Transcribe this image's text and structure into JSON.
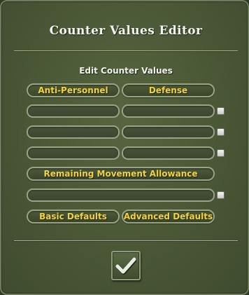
{
  "dialog": {
    "title": "Counter Values Editor",
    "subtitle": "Edit Counter Values"
  },
  "buttons": {
    "anti_personnel": "Anti-Personnel",
    "defense": "Defense",
    "remaining_movement": "Remaining Movement Allowance",
    "basic_defaults": "Basic Defaults",
    "advanced_defaults": "Advanced Defaults"
  },
  "fields": {
    "row1_left": "",
    "row1_right": "",
    "row2_left": "",
    "row2_right": "",
    "row3_left": "",
    "row3_right": "",
    "movement": ""
  },
  "ok_button": {
    "icon": "checkmark-icon"
  },
  "colors": {
    "panel": "#4a5736",
    "button_text": "#f2d43a",
    "title_text": "#f4f4ee",
    "border": "#9aa387"
  }
}
